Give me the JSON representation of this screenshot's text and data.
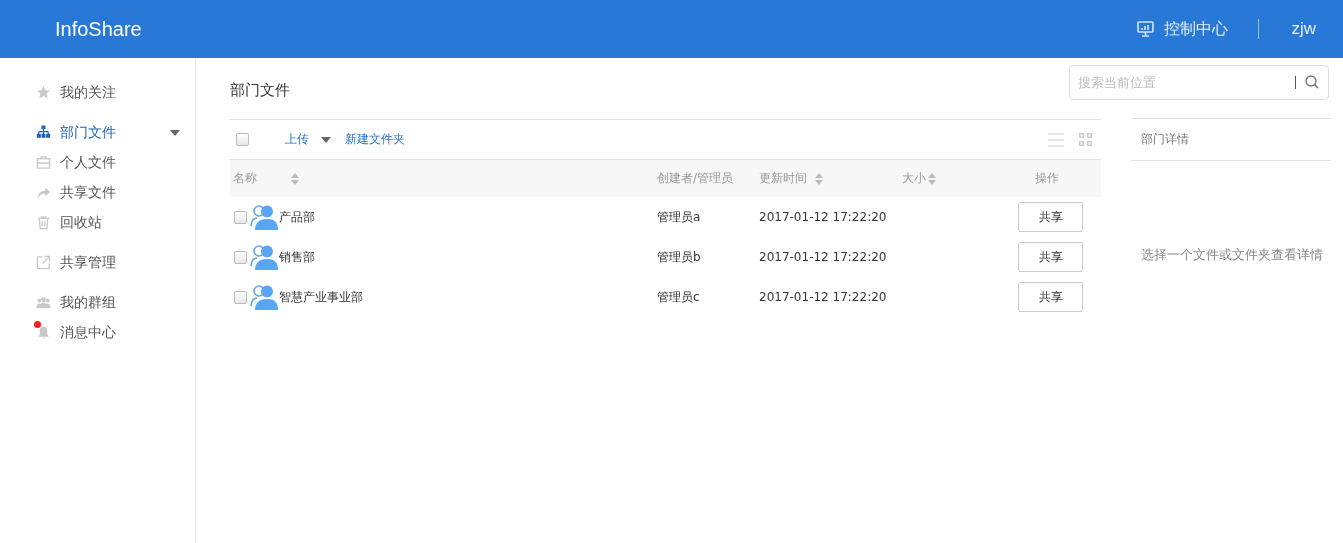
{
  "header": {
    "brand": "InfoShare",
    "control_center": "控制中心",
    "user": "zjw"
  },
  "sidebar": {
    "groups": [
      {
        "items": [
          {
            "label": "我的关注",
            "selected": false,
            "badge": false
          }
        ]
      },
      {
        "items": [
          {
            "label": "部门文件",
            "selected": true,
            "expanded": true,
            "badge": false
          },
          {
            "label": "个人文件",
            "selected": false,
            "badge": false
          },
          {
            "label": "共享文件",
            "selected": false,
            "badge": false
          },
          {
            "label": "回收站",
            "selected": false,
            "badge": false
          }
        ]
      },
      {
        "items": [
          {
            "label": "共享管理",
            "selected": false,
            "badge": false
          }
        ]
      },
      {
        "items": [
          {
            "label": "我的群组",
            "selected": false,
            "badge": false
          },
          {
            "label": "消息中心",
            "selected": false,
            "badge": true
          }
        ]
      }
    ]
  },
  "page_title": "部门文件",
  "search": {
    "placeholder": "搜索当前位置"
  },
  "toolbar": {
    "select_all": false,
    "upload": "上传",
    "new_folder": "新建文件夹"
  },
  "table": {
    "columns": [
      {
        "label": "名称",
        "sortable": true
      },
      {
        "label": "创建者/管理员",
        "sortable": false
      },
      {
        "label": "更新时间",
        "sortable": true
      },
      {
        "label": "大小",
        "sortable": true
      },
      {
        "label": "操作",
        "sortable": false
      }
    ],
    "rows": [
      {
        "checked": false,
        "name": "产品部",
        "creator": "管理员a",
        "updated": "2017-01-12 17:22:20",
        "action": "共享"
      },
      {
        "checked": false,
        "name": "销售部",
        "creator": "管理员b",
        "updated": "2017-01-12 17:22:20",
        "action": "共享"
      },
      {
        "checked": false,
        "name": "智慧产业事业部",
        "creator": "管理员c",
        "updated": "2017-01-12 17:22:20",
        "action": "共享"
      }
    ]
  },
  "details": {
    "title": "部门详情",
    "empty_text": "选择一个文件或文件夹查看详情"
  }
}
